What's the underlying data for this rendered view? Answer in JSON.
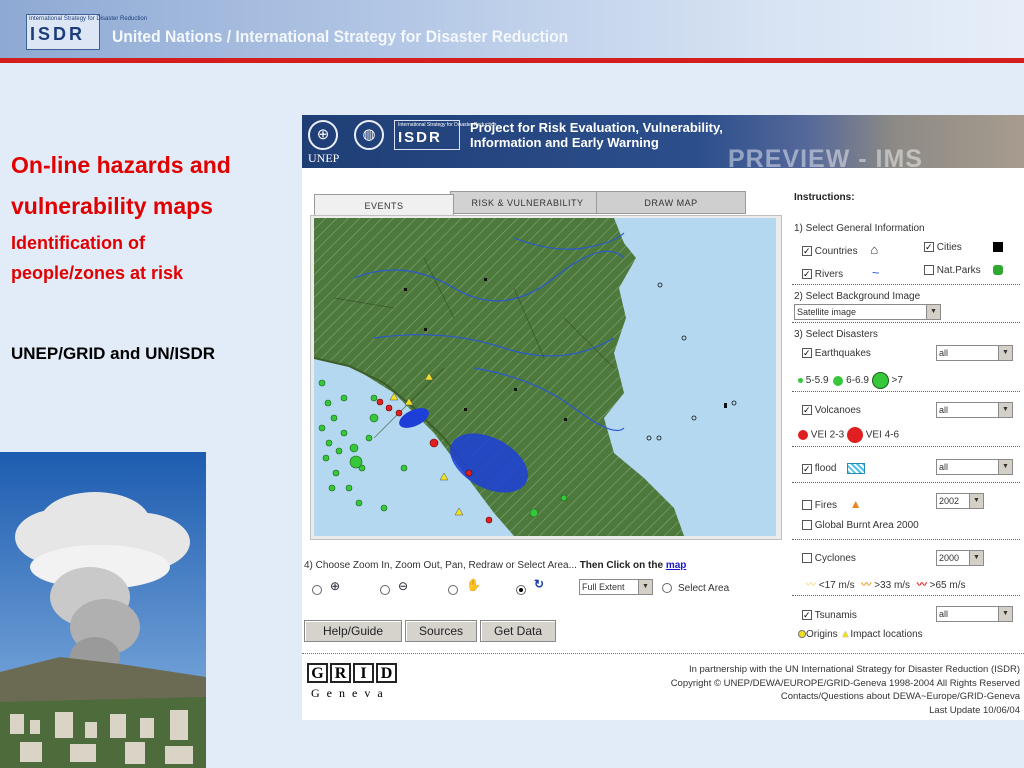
{
  "slide": {
    "logo_small": "International Strategy for Disaster Reduction",
    "logo_main": "ISDR",
    "header_title": "United Nations / International Strategy for Disaster Reduction",
    "title_line1": "On-line hazards and",
    "title_line2": "vulnerability maps",
    "subtitle_line1": "Identification of",
    "subtitle_line2": "people/zones at risk",
    "credit": "UNEP/GRID and UN/ISDR"
  },
  "app": {
    "banner": {
      "unep": "UNEP",
      "isdr_small": "International Strategy for Disaster Reduction",
      "isdr_main": "ISDR",
      "project_line1": "Project for Risk Evaluation, Vulnerability,",
      "project_line2": "Information and Early Warning",
      "preview": "PREVIEW - IMS"
    },
    "tabs": [
      "EVENTS",
      "RISK & VULNERABILITY",
      "DRAW MAP"
    ],
    "instructions": {
      "heading": "Instructions:",
      "step1": "1) Select General Information",
      "countries": "Countries",
      "cities": "Cities",
      "rivers": "Rivers",
      "natparks": "Nat.Parks",
      "step2": "2) Select Background Image",
      "background_value": "Satellite image",
      "step3": "3) Select Disasters",
      "earthquakes": "Earthquakes",
      "eq_select": "all",
      "eq_legend": [
        "5-5.9",
        "6-6.9",
        ">7"
      ],
      "volcanoes": "Volcanoes",
      "volc_select": "all",
      "volc_legend": [
        "VEI 2-3",
        "VEI 4-6"
      ],
      "flood": "flood",
      "flood_select": "all",
      "fires": "Fires",
      "fires_select": "2002",
      "burnt": "Global Burnt Area 2000",
      "cyclones": "Cyclones",
      "cyc_select": "2000",
      "cyc_legend": [
        "<17 m/s",
        ">33 m/s",
        ">65 m/s"
      ],
      "tsunamis": "Tsunamis",
      "tsu_select": "all",
      "tsu_legend": [
        "Origins",
        "Impact locations"
      ]
    },
    "zoom": {
      "instruction": "4) Choose Zoom In, Zoom Out, Pan, Redraw or Select Area...",
      "then": "Then Click on the",
      "map_link": "map",
      "extent_value": "Full Extent",
      "select_area": "Select Area"
    },
    "buttons": {
      "help": "Help/Guide",
      "sources": "Sources",
      "data": "Get Data"
    },
    "footer": {
      "grid_letters": [
        "G",
        "R",
        "I",
        "D"
      ],
      "geneva": "Geneva",
      "line1": "In partnership with the UN International Strategy for Disaster Reduction (ISDR)",
      "line2": "Copyright © UNEP/DEWA/EUROPE/GRID-Geneva 1998-2004 All Rights Reserved",
      "line3": "Contacts/Questions about DEWA~Europe/GRID-Geneva",
      "line4": "Last Update 10/06/04"
    }
  },
  "colors": {
    "title_red": "#e00000",
    "rule_red": "#d41e1e",
    "banner_blue": "#1f3e76",
    "link_blue": "#1a1acc"
  }
}
